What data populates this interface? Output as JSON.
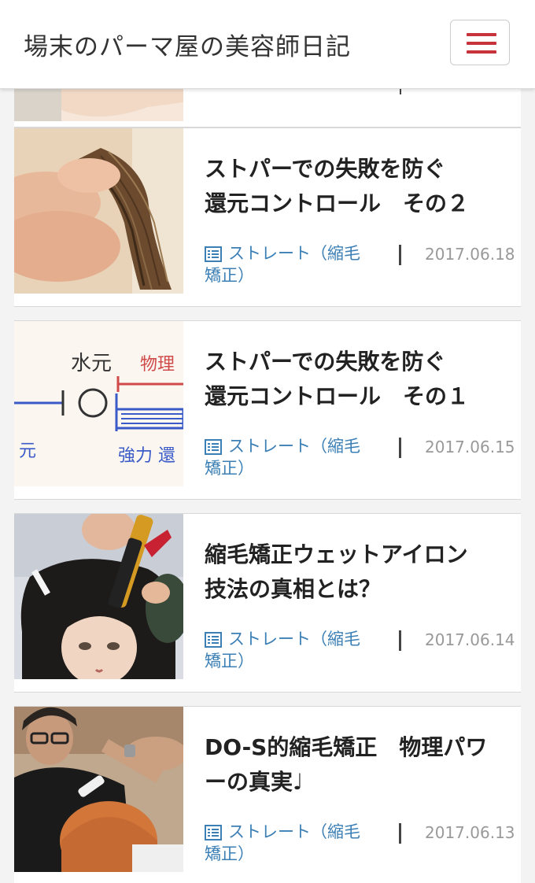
{
  "header": {
    "site_title": "場末のパーマ屋の美容師日記",
    "menu_button_icon": "hamburger-icon",
    "accent_color": "#c8323a"
  },
  "posts": [
    {
      "title_line1": "ストパーでの失敗を防ぐ",
      "title_line2": "還元コントロール　その２",
      "category_line1": "ストレート（縮毛",
      "category_line2": "矯正）",
      "category_icon": "list-icon",
      "date": "2017.06.18"
    },
    {
      "title_line1": "ストパーでの失敗を防ぐ",
      "title_line2": "還元コントロール　その１",
      "category_line1": "ストレート（縮毛",
      "category_line2": "矯正）",
      "category_icon": "list-icon",
      "date": "2017.06.15"
    },
    {
      "title_line1": "縮毛矯正ウェットアイロン",
      "title_line2": "技法の真相とは？",
      "category_line1": "ストレート（縮毛",
      "category_line2": "矯正）",
      "category_icon": "list-icon",
      "date": "2017.06.14"
    },
    {
      "title_line1": "DO-S的縮毛矯正　物理パワ",
      "title_line2": "ーの真実♩",
      "category_line1": "ストレート（縮毛",
      "category_line2": "矯正）",
      "category_icon": "list-icon",
      "date": "2017.06.13"
    }
  ],
  "thumb2_text": {
    "left_top": "水元",
    "right_top": "物理",
    "left_bottom": "元",
    "right_bottom": "強力 還"
  },
  "colors": {
    "link": "#3b7fb5",
    "date": "#999999",
    "title": "#222222"
  }
}
